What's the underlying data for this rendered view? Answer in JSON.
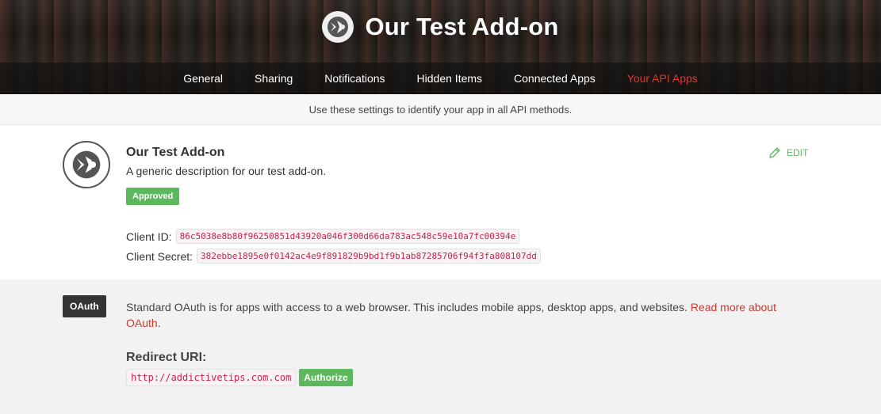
{
  "header": {
    "title": "Our Test Add-on",
    "logo_icon": "addon-logo-icon"
  },
  "nav": {
    "items": [
      {
        "label": "General",
        "active": false
      },
      {
        "label": "Sharing",
        "active": false
      },
      {
        "label": "Notifications",
        "active": false
      },
      {
        "label": "Hidden Items",
        "active": false
      },
      {
        "label": "Connected Apps",
        "active": false
      },
      {
        "label": "Your API Apps",
        "active": true
      }
    ],
    "active_color": "#e0362e"
  },
  "subheader": {
    "text": "Use these settings to identify your app in all API methods."
  },
  "app": {
    "name": "Our Test Add-on",
    "description": "A generic description for our test add-on.",
    "status": "Approved",
    "status_color": "#5cb85c",
    "edit_label": "EDIT",
    "edit_icon": "pencil-icon",
    "client_id_label": "Client ID:",
    "client_id": "86c5038e8b80f96250851d43920a046f300d66da783ac548c59e10a7fc00394e",
    "client_secret_label": "Client Secret:",
    "client_secret": "382ebbe1895e0f0142ac4e9f891829b9bd1f9b1ab87285706f94f3fa808107dd"
  },
  "oauth": {
    "badge": "OAuth",
    "description": "Standard OAuth is for apps with access to a web browser. This includes mobile apps, desktop apps, and websites.",
    "read_more_label": "Read more about OAuth",
    "redirect_label": "Redirect URI:",
    "redirect_uri": "http://addictivetips.com.com",
    "authorize_label": "Authorize"
  }
}
